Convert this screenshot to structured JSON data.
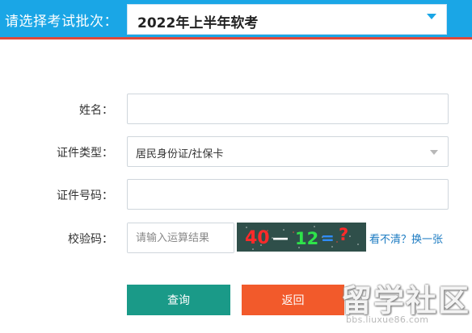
{
  "header": {
    "label": "请选择考试批次：",
    "batch_value": "2022年上半年软考"
  },
  "form": {
    "name_label": "姓名：",
    "name_value": "",
    "id_type_label": "证件类型：",
    "id_type_value": "居民身份证/社保卡",
    "id_number_label": "证件号码：",
    "id_number_value": "",
    "captcha_label": "校验码：",
    "captcha_placeholder": "请输入运算结果",
    "captcha_text": {
      "a": "40",
      "op": "—",
      "b": "12",
      "eq": "=",
      "q": "?"
    },
    "refresh_label": "看不清？换一张"
  },
  "buttons": {
    "query_label": "查询",
    "back_label": "返回"
  },
  "watermark": {
    "title": "留学社区",
    "url": "bbs.liuxue86.com"
  },
  "colors": {
    "topbar": "#1aa6e6",
    "accent_line": "#e0483a",
    "query_button": "#1a9a88",
    "back_button": "#f25a2b",
    "link": "#1c7bc2"
  }
}
